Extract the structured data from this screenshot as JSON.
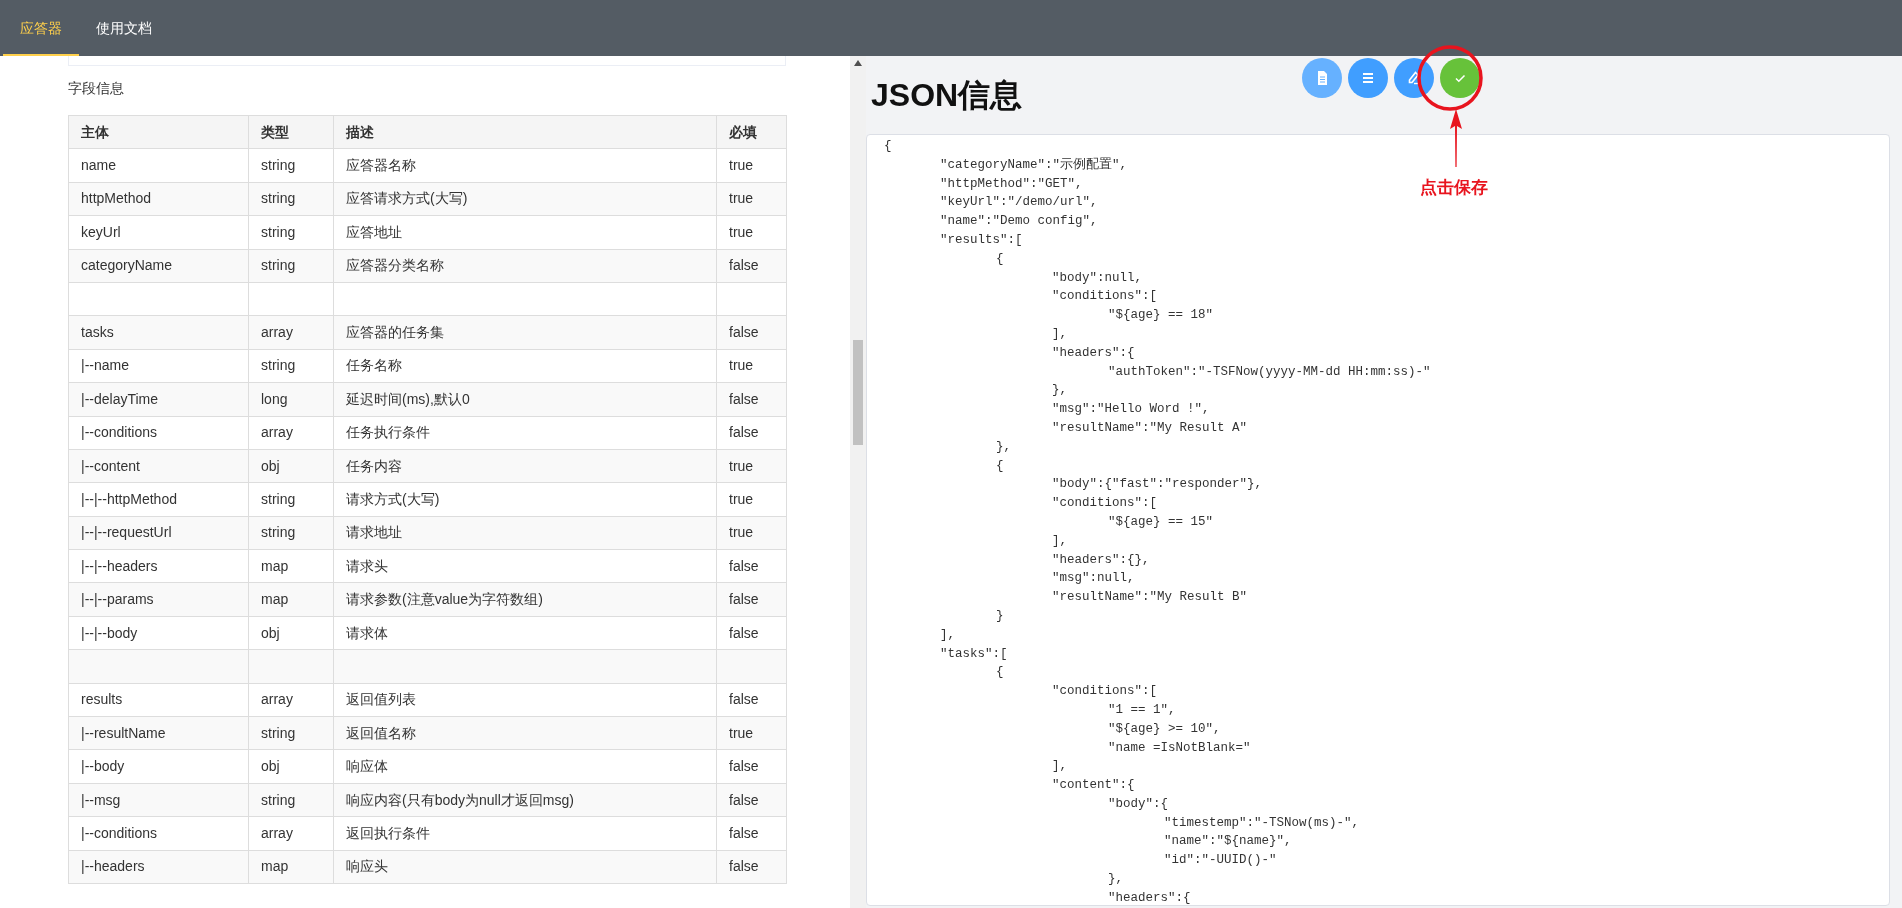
{
  "nav": {
    "tabs": [
      {
        "label": "应答器",
        "selected": true
      },
      {
        "label": "使用文档",
        "selected": false
      }
    ]
  },
  "fields": {
    "title": "字段信息",
    "columns": [
      "主体",
      "类型",
      "描述",
      "必填"
    ],
    "rows": [
      {
        "kind": "field",
        "cells": [
          "name",
          "string",
          "应答器名称",
          "true"
        ]
      },
      {
        "kind": "field",
        "cells": [
          "httpMethod",
          "string",
          "应答请求方式(大写)",
          "true"
        ]
      },
      {
        "kind": "field",
        "cells": [
          "keyUrl",
          "string",
          "应答地址",
          "true"
        ]
      },
      {
        "kind": "field",
        "cells": [
          "categoryName",
          "string",
          "应答器分类名称",
          "false"
        ]
      },
      {
        "kind": "blank"
      },
      {
        "kind": "field",
        "cells": [
          "tasks",
          "array",
          "应答器的任务集",
          "false"
        ]
      },
      {
        "kind": "field",
        "cells": [
          "|--name",
          "string",
          "任务名称",
          "true"
        ]
      },
      {
        "kind": "field",
        "cells": [
          "|--delayTime",
          "long",
          "延迟时间(ms),默认0",
          "false"
        ]
      },
      {
        "kind": "field",
        "cells": [
          "|--conditions",
          "array",
          "任务执行条件",
          "false"
        ]
      },
      {
        "kind": "field",
        "cells": [
          "|--content",
          "obj",
          "任务内容",
          "true"
        ]
      },
      {
        "kind": "field",
        "cells": [
          "|--|--httpMethod",
          "string",
          "请求方式(大写)",
          "true"
        ]
      },
      {
        "kind": "field",
        "cells": [
          "|--|--requestUrl",
          "string",
          "请求地址",
          "true"
        ]
      },
      {
        "kind": "field",
        "cells": [
          "|--|--headers",
          "map",
          "请求头",
          "false"
        ]
      },
      {
        "kind": "field",
        "cells": [
          "|--|--params",
          "map",
          "请求参数(注意value为字符数组)",
          "false"
        ]
      },
      {
        "kind": "field",
        "cells": [
          "|--|--body",
          "obj",
          "请求体",
          "false"
        ]
      },
      {
        "kind": "blank"
      },
      {
        "kind": "field",
        "cells": [
          "results",
          "array",
          "返回值列表",
          "false"
        ]
      },
      {
        "kind": "field",
        "cells": [
          "|--resultName",
          "string",
          "返回值名称",
          "true"
        ]
      },
      {
        "kind": "field",
        "cells": [
          "|--body",
          "obj",
          "响应体",
          "false"
        ]
      },
      {
        "kind": "field",
        "cells": [
          "|--msg",
          "string",
          "响应内容(只有body为null才返回msg)",
          "false"
        ]
      },
      {
        "kind": "field",
        "cells": [
          "|--conditions",
          "array",
          "返回执行条件",
          "false"
        ]
      },
      {
        "kind": "field",
        "cells": [
          "|--headers",
          "map",
          "响应头",
          "false"
        ]
      }
    ]
  },
  "json_panel": {
    "title": "JSON信息",
    "buttons": [
      {
        "kind": "document",
        "disabled": true
      },
      {
        "kind": "format",
        "disabled": false
      },
      {
        "kind": "edit",
        "disabled": false
      },
      {
        "kind": "save",
        "disabled": false
      }
    ],
    "annotation": {
      "text": "点击保存"
    },
    "code_lines": [
      "{",
      "\t\"categoryName\":\"示例配置\",",
      "\t\"httpMethod\":\"GET\",",
      "\t\"keyUrl\":\"/demo/url\",",
      "\t\"name\":\"Demo config\",",
      "\t\"results\":[",
      "\t\t{",
      "\t\t\t\"body\":null,",
      "\t\t\t\"conditions\":[",
      "\t\t\t\t\"${age} == 18\"",
      "\t\t\t],",
      "\t\t\t\"headers\":{",
      "\t\t\t\t\"authToken\":\"-TSFNow(yyyy-MM-dd HH:mm:ss)-\"",
      "\t\t\t},",
      "\t\t\t\"msg\":\"Hello Word !\",",
      "\t\t\t\"resultName\":\"My Result A\"",
      "\t\t},",
      "\t\t{",
      "\t\t\t\"body\":{\"fast\":\"responder\"},",
      "\t\t\t\"conditions\":[",
      "\t\t\t\t\"${age} == 15\"",
      "\t\t\t],",
      "\t\t\t\"headers\":{},",
      "\t\t\t\"msg\":null,",
      "\t\t\t\"resultName\":\"My Result B\"",
      "\t\t}",
      "\t],",
      "\t\"tasks\":[",
      "\t\t{",
      "\t\t\t\"conditions\":[",
      "\t\t\t\t\"1 == 1\",",
      "\t\t\t\t\"${age} >= 10\",",
      "\t\t\t\t\"name =IsNotBlank=\"",
      "\t\t\t],",
      "\t\t\t\"content\":{",
      "\t\t\t\t\"body\":{",
      "\t\t\t\t\t\"timestemp\":\"-TSNow(ms)-\",",
      "\t\t\t\t\t\"name\":\"${name}\",",
      "\t\t\t\t\t\"id\":\"-UUID()-\"",
      "\t\t\t\t},",
      "\t\t\t\t\"headers\":{"
    ]
  }
}
